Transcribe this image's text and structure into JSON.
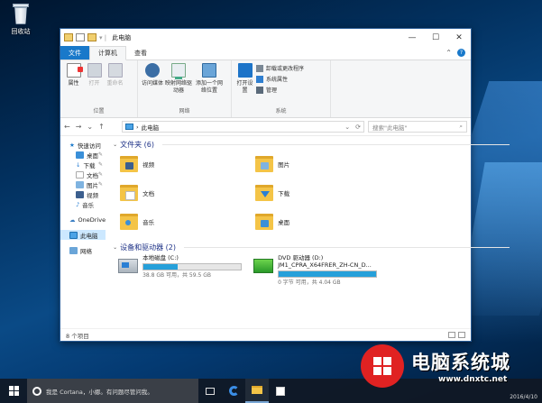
{
  "desktop": {
    "recycle_bin_label": "回收站"
  },
  "window": {
    "title": "此电脑",
    "controls": {
      "minimize": "—",
      "maximize": "☐",
      "close": "✕"
    }
  },
  "ribbon_tabs": {
    "file": "文件",
    "computer": "计算机",
    "view": "查看"
  },
  "ribbon": {
    "location": {
      "label": "位置",
      "properties": "属性",
      "open": "打开",
      "rename": "重命名"
    },
    "network": {
      "label": "网络",
      "media": "访问媒体",
      "map_drive": "映射网络驱动器",
      "add_location": "添加一个网络位置"
    },
    "system": {
      "label": "系统",
      "open_settings": "打开设置",
      "uninstall": "卸载或更改程序",
      "sys_props": "系统属性",
      "manage": "管理"
    }
  },
  "address": {
    "path": "此电脑",
    "search_placeholder": "搜索\"此电脑\""
  },
  "nav": {
    "quick_access": "快速访问",
    "desktop": "桌面",
    "downloads": "下载",
    "documents": "文档",
    "pictures": "图片",
    "videos": "视频",
    "music": "音乐",
    "onedrive": "OneDrive",
    "this_pc": "此电脑",
    "network": "网络"
  },
  "sections": {
    "folders_header": "文件夹 (6)",
    "drives_header": "设备和驱动器 (2)"
  },
  "folders": [
    "视频",
    "图片",
    "文档",
    "下载",
    "音乐",
    "桌面"
  ],
  "drives": [
    {
      "name": "本地磁盘 (C:)",
      "sub": "38.8 GB 可用，共 59.5 GB",
      "used_fraction": 0.35
    },
    {
      "name": "DVD 驱动器 (D:)",
      "name2": "JM1_CPRA_X64FRER_ZH-CN_D...",
      "sub": "0 字节 可用，共 4.04 GB",
      "used_fraction": 1.0
    }
  ],
  "statusbar": {
    "items": "8 个项目"
  },
  "taskbar": {
    "search_text": "我是 Cortana，小娜。有问题尽管问我。"
  },
  "watermark": {
    "title": "电脑系统城",
    "url": "www.dnxtc.net",
    "date": "2016/4/10"
  },
  "colors": {
    "accent": "#1979ca",
    "selection": "#cce8ff",
    "header_blue": "#1e3287",
    "drive_bar": "#26a0da"
  }
}
